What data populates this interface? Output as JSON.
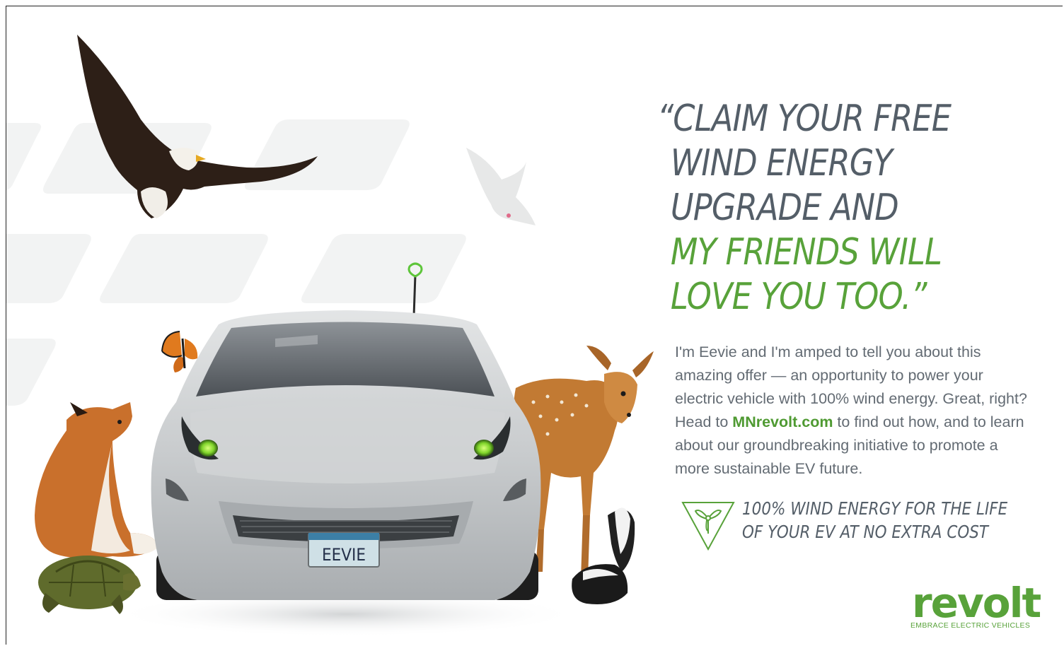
{
  "headline": {
    "line1": "“CLAIM YOUR FREE",
    "line2": "WIND ENERGY",
    "line3": "UPGRADE AND",
    "line4": "MY FRIENDS WILL",
    "line5": "LOVE YOU TOO.”"
  },
  "body": {
    "before_link": "I'm Eevie and I'm amped to tell you about this amazing offer — an opportunity to power your electric vehicle with 100% wind energy. Great, right? Head to ",
    "link": "MNrevolt.com",
    "after_link": " to find out how, and to learn about our groundbreaking initiative to promote a more sustainable EV future."
  },
  "tagline": {
    "line1": "100% WIND ENERGY FOR THE LIFE",
    "line2": "OF YOUR EV AT NO EXTRA COST"
  },
  "badge": {
    "icon": "wind-turbine-icon"
  },
  "plate": {
    "text": "EEVIE"
  },
  "logo": {
    "wordmark": "revolt",
    "tag": "EMBRACE ELECTRIC VEHICLES"
  },
  "colors": {
    "green": "#58a23a",
    "slate": "#545e68",
    "car_silver": "#c9ccce"
  }
}
